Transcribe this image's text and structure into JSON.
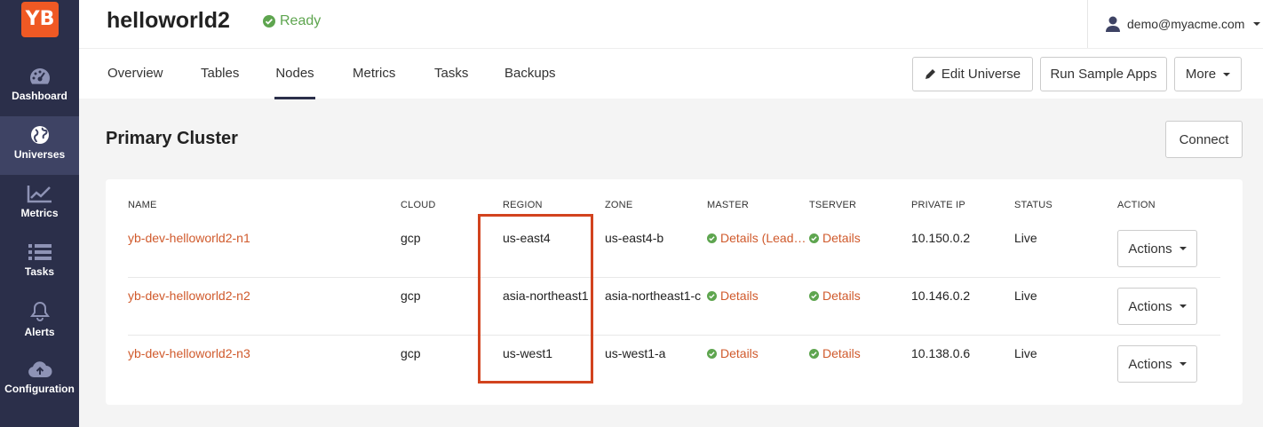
{
  "sidebar": {
    "logo": "YB",
    "items": [
      {
        "label": "Dashboard",
        "icon": "dashboard-icon"
      },
      {
        "label": "Universes",
        "icon": "globe-icon"
      },
      {
        "label": "Metrics",
        "icon": "metrics-icon"
      },
      {
        "label": "Tasks",
        "icon": "tasks-icon"
      },
      {
        "label": "Alerts",
        "icon": "bell-icon"
      },
      {
        "label": "Configuration",
        "icon": "cloud-upload-icon"
      }
    ]
  },
  "header": {
    "title": "helloworld2",
    "status": "Ready",
    "user": "demo@myacme.com"
  },
  "tabs": [
    "Overview",
    "Tables",
    "Nodes",
    "Metrics",
    "Tasks",
    "Backups"
  ],
  "active_tab": "Nodes",
  "toolbar": {
    "edit": "Edit Universe",
    "sample": "Run Sample Apps",
    "more": "More"
  },
  "cluster": {
    "title": "Primary Cluster",
    "connect": "Connect"
  },
  "table": {
    "columns": [
      "NAME",
      "CLOUD",
      "REGION",
      "ZONE",
      "MASTER",
      "TSERVER",
      "PRIVATE IP",
      "STATUS",
      "ACTION"
    ],
    "rows": [
      {
        "name": "yb-dev-helloworld2-n1",
        "cloud": "gcp",
        "region": "us-east4",
        "zone": "us-east4-b",
        "master": "Details (Lead…",
        "tserver": "Details",
        "ip": "10.150.0.2",
        "status": "Live",
        "action": "Actions"
      },
      {
        "name": "yb-dev-helloworld2-n2",
        "cloud": "gcp",
        "region": "asia-northeast1",
        "zone": "asia-northeast1-c",
        "master": "Details",
        "tserver": "Details",
        "ip": "10.146.0.2",
        "status": "Live",
        "action": "Actions"
      },
      {
        "name": "yb-dev-helloworld2-n3",
        "cloud": "gcp",
        "region": "us-west1",
        "zone": "us-west1-a",
        "master": "Details",
        "tserver": "Details",
        "ip": "10.138.0.6",
        "status": "Live",
        "action": "Actions"
      }
    ]
  },
  "colors": {
    "sidebar": "#2b2f4a",
    "accent": "#ef5924",
    "link": "#d05a2c",
    "ready": "#5ea54f",
    "highlight": "#d2431e"
  }
}
